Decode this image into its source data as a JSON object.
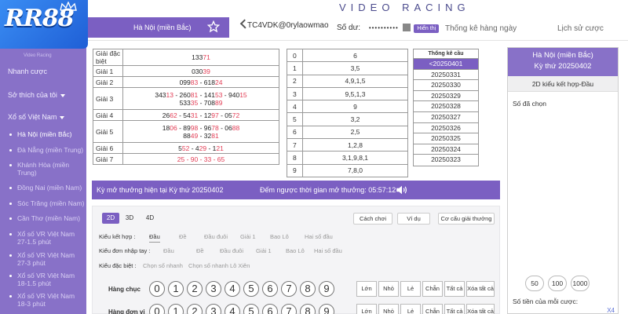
{
  "header": {
    "brand": "RR88",
    "banner_title": "VIDEO RACING",
    "lottery_tab": "Hà Nội (miền Bắc)",
    "username": "TC4VDK@0rylaowmao",
    "balance_label": "Số dư:",
    "balance_mask": "••••••••••",
    "show_label": "Hiển thị",
    "nav": [
      "Thống kê hàng ngày",
      "Lịch sử cược"
    ]
  },
  "sidebar": {
    "faded_text": "Video Racing",
    "items": [
      {
        "label": "Nhanh cược"
      },
      {
        "label": "Sở thích của tôi"
      },
      {
        "label": "Xổ số Việt Nam"
      }
    ],
    "sub_items": [
      "Hà Nội (miền Bắc)",
      "Đà Nẵng (miền Trung)",
      "Khánh Hòa (miền Trung)",
      "Đồng Nai (miền Nam)",
      "Sóc Trăng (miền Nam)",
      "Cần Thơ (miền Nam)",
      "Xổ số VR Việt Nam 27-1.5 phút",
      "Xổ số VR Việt Nam 27-3 phút",
      "Xổ số VR Việt Nam 18-1.5 phút",
      "Xổ số VR Việt Nam 18-3 phút"
    ]
  },
  "results": {
    "special_label": "Giải đặc biệt",
    "special": {
      "plain": "133",
      "red": "71"
    },
    "rows": [
      {
        "label": "Giải 1",
        "lines": [
          [
            {
              "t": "030",
              "r": "39"
            }
          ]
        ]
      },
      {
        "label": "Giải 2",
        "lines": [
          [
            {
              "t": "099",
              "r": "83"
            },
            {
              "t": " - 618",
              "r": "24"
            }
          ]
        ]
      },
      {
        "label": "Giải 3",
        "lines": [
          [
            {
              "t": "343",
              "r": "13"
            },
            {
              "t": " - 260",
              "r": "81"
            },
            {
              "t": " - 141",
              "r": "53"
            },
            {
              "t": " - 940",
              "r": "15"
            }
          ],
          [
            {
              "t": "533",
              "r": "35"
            },
            {
              "t": " - 708",
              "r": "89"
            }
          ]
        ]
      },
      {
        "label": "Giải 4",
        "lines": [
          [
            {
              "t": "26",
              "r": "62"
            },
            {
              "t": " - 54",
              "r": "31"
            },
            {
              "t": " - 12",
              "r": "97"
            },
            {
              "t": " - 05",
              "r": "72"
            }
          ]
        ]
      },
      {
        "label": "Giải 5",
        "lines": [
          [
            {
              "t": "18",
              "r": "06"
            },
            {
              "t": " - 89",
              "r": "98"
            },
            {
              "t": " - 96",
              "r": "78"
            },
            {
              "t": " - 06",
              "r": "88"
            }
          ],
          [
            {
              "t": "88",
              "r": "49"
            },
            {
              "t": " - 32",
              "r": "81"
            }
          ]
        ]
      },
      {
        "label": "Giải 6",
        "lines": [
          [
            {
              "t": "5",
              "r": "52"
            },
            {
              "t": " - 4",
              "r": "29"
            },
            {
              "t": " - 1",
              "r": "21"
            }
          ]
        ]
      },
      {
        "label": "Giải 7",
        "lines": [
          [
            {
              "t": "",
              "r": "25 - 90 - 33 - 65"
            }
          ]
        ]
      }
    ]
  },
  "head_tail": [
    {
      "d": "0",
      "v": "6"
    },
    {
      "d": "1",
      "v": "3,5"
    },
    {
      "d": "2",
      "v": "4,9,1,5"
    },
    {
      "d": "3",
      "v": "9,5,1,3"
    },
    {
      "d": "4",
      "v": "9"
    },
    {
      "d": "5",
      "v": "3,2"
    },
    {
      "d": "6",
      "v": "2,5"
    },
    {
      "d": "7",
      "v": "1,2,8"
    },
    {
      "d": "8",
      "v": "3,1,9,8,1"
    },
    {
      "d": "9",
      "v": "7,8,0"
    }
  ],
  "stats": {
    "header": "Thống kê cầu",
    "rows": [
      "<20250401",
      "20250331",
      "20250330",
      "20250329",
      "20250328",
      "20250327",
      "20250326",
      "20250325",
      "20250324",
      "20250323"
    ],
    "selected_index": 0
  },
  "right_panel": {
    "title": "Hà Nội (miền Bắc)",
    "period": "Kỳ thứ 20250402",
    "mode": "2D kiểu kết hợp-Đầu",
    "selected_label": "Số đã chọn",
    "chips": [
      "50",
      "100",
      "1000"
    ],
    "money_label": "Số tiền của mỗi cược:",
    "multiplier": "X4"
  },
  "draw_banner": {
    "period_text": "Kỳ mở thưởng hiện tại Kỳ thứ 20250402",
    "countdown_text": "Đếm ngược thời gian mở thưởng: 05:57:12"
  },
  "bet": {
    "tabs": [
      "2D",
      "3D",
      "4D"
    ],
    "active_tab": 0,
    "buttons": [
      "Cách chơi",
      "Ví dụ",
      "Cơ cấu giải thưởng"
    ],
    "rows": [
      {
        "label": "Kiểu kết hợp :",
        "options": [
          "Đầu",
          "Đề",
          "Đầu đuôi",
          "Giải 1",
          "Bao Lô",
          "Hai số đầu"
        ],
        "active": 0
      },
      {
        "label": "Kiểu đơn nhập tay :",
        "options": [
          "Đầu",
          "Đề",
          "Đầu đuôi",
          "Giải 1",
          "Bao Lô",
          "Hai số đầu"
        ],
        "active": -1
      },
      {
        "label": "Kiểu đặc biệt :",
        "options": [
          "Chọn số nhanh",
          "Chọn số nhanh Lô Xiên"
        ],
        "active": -1
      }
    ],
    "number_rows": [
      "Hàng chục",
      "Hàng đơn vị"
    ],
    "digits": [
      "0",
      "1",
      "2",
      "3",
      "4",
      "5",
      "6",
      "7",
      "8",
      "9"
    ],
    "quick": [
      "Lớn",
      "Nhỏ",
      "Lẻ",
      "Chẵn",
      "Tất cả",
      "Xóa tất cả"
    ]
  },
  "colors": {
    "accent": "#7b5fc2",
    "sidebar": "#8871c8",
    "brand": "#2a6fe8",
    "highlight": "#e23d55"
  }
}
